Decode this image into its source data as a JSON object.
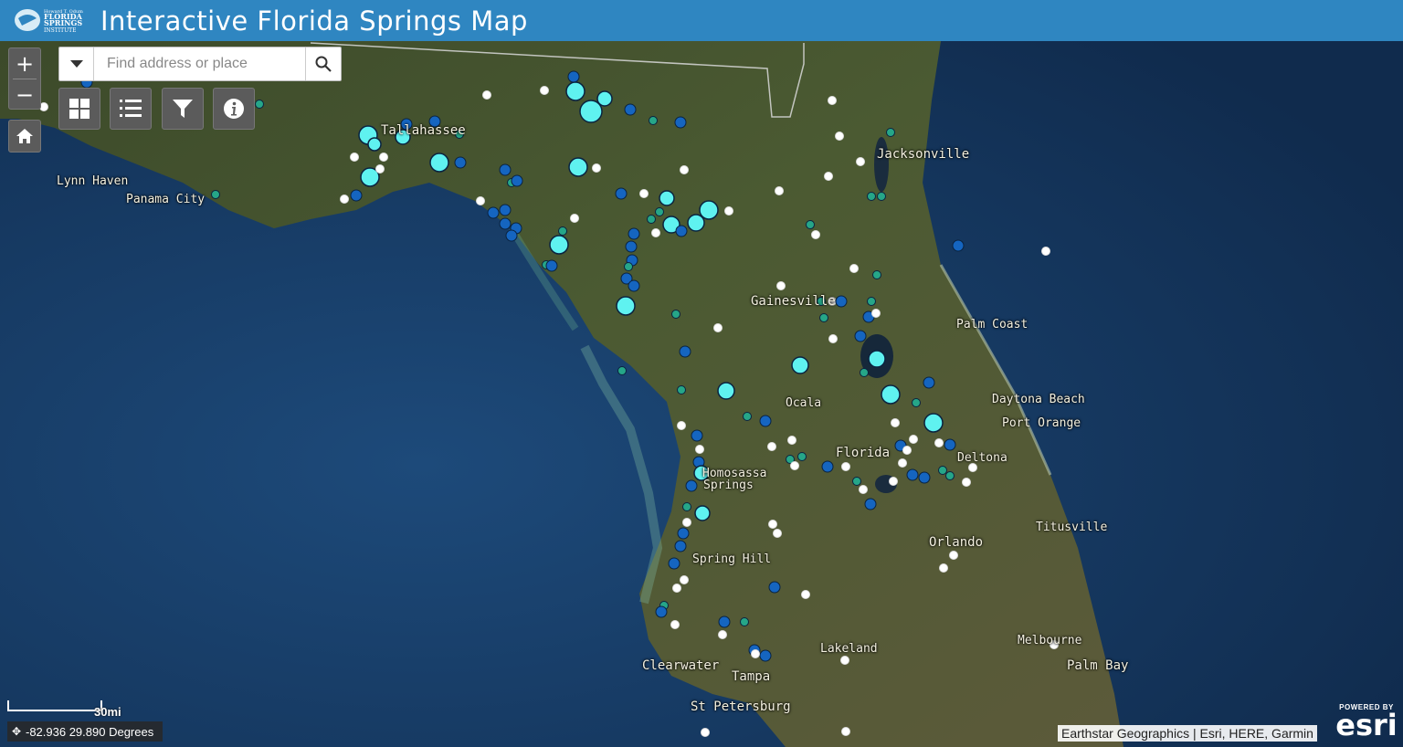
{
  "header": {
    "title": "Interactive Florida Springs Map",
    "logo_text": [
      "Howard T. Odum",
      "FLORIDA",
      "SPRINGS",
      "INSTITUTE"
    ]
  },
  "controls": {
    "zoom_in": "+",
    "zoom_out": "−",
    "search_placeholder": "Find address or place",
    "tools": [
      "basemap-gallery-icon",
      "legend-list-icon",
      "filter-icon",
      "info-icon"
    ],
    "home": "home-icon"
  },
  "places": [
    "Tallahassee",
    "Lynn Haven",
    "Panama City",
    "Jacksonville",
    "Gainesville",
    "Palm Coast",
    "Daytona Beach",
    "Port Orange",
    "Ocala",
    "Florida",
    "Deltona",
    "Homosassa",
    "Springs",
    "Titusville",
    "Orlando",
    "Spring Hill",
    "Lakeland",
    "Melbourne",
    "Palm Bay",
    "Clearwater",
    "Tampa",
    "St Petersburg"
  ],
  "legend_colors": {
    "white": "#ffffff",
    "dark_blue": "#1565c0",
    "teal": "#26a688",
    "cyan": "#5ff2f0"
  },
  "scale": {
    "label": "30mi"
  },
  "coordinates": {
    "text": "-82.936 29.890 Degrees"
  },
  "attribution": "Earthstar Geographics | Esri, HERE, Garmin",
  "esri": {
    "powered": "POWERED BY",
    "name": "esri"
  }
}
